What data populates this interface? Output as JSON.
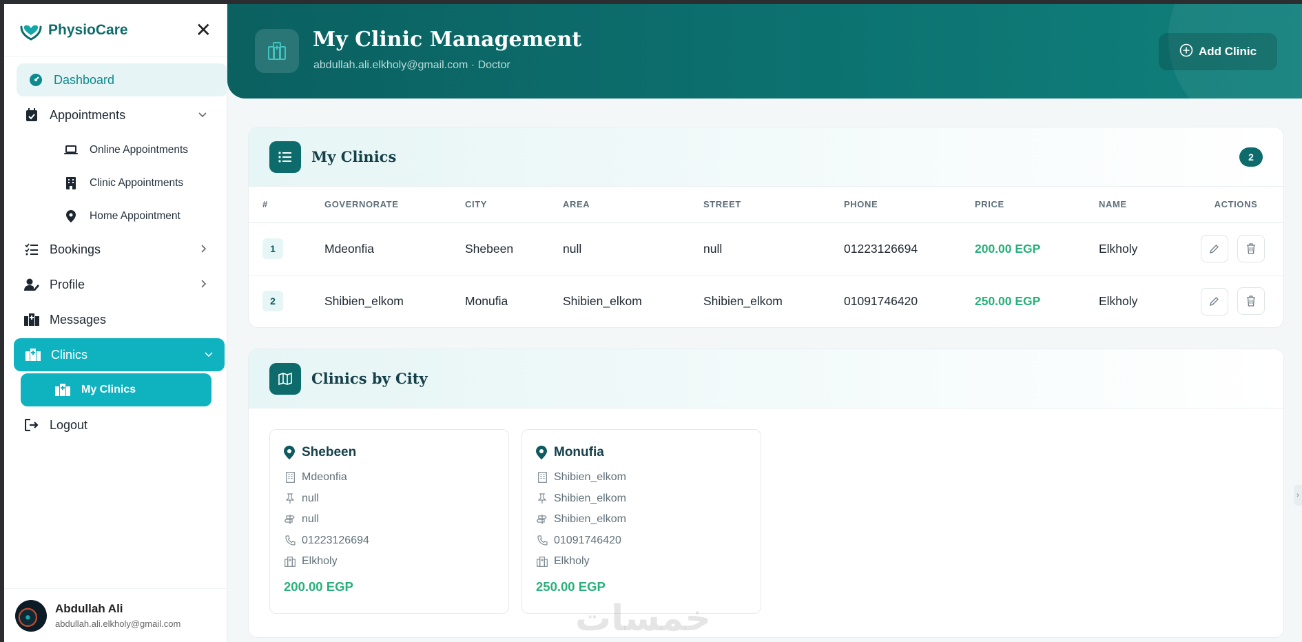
{
  "brand": {
    "name": "PhysioCare",
    "close_label": "✕"
  },
  "sidebar": {
    "dashboard": "Dashboard",
    "appointments": "Appointments",
    "appointment_items": [
      "Online Appointments",
      "Clinic Appointments",
      "Home Appointment"
    ],
    "bookings": "Bookings",
    "profile": "Profile",
    "messages": "Messages",
    "clinics": "Clinics",
    "my_clinics": "My Clinics",
    "logout": "Logout"
  },
  "user": {
    "name": "Abdullah Ali",
    "email": "abdullah.ali.elkholy@gmail.com"
  },
  "header": {
    "title": "My Clinic Management",
    "subtitle": "abdullah.ali.elkholy@gmail.com · Doctor",
    "add_button": "Add Clinic"
  },
  "clinics_table": {
    "title": "My Clinics",
    "count": "2",
    "columns": [
      "#",
      "GOVERNORATE",
      "CITY",
      "AREA",
      "STREET",
      "PHONE",
      "PRICE",
      "NAME",
      "ACTIONS"
    ],
    "rows": [
      {
        "num": "1",
        "governorate": "Mdeonfia",
        "city": "Shebeen",
        "area": "null",
        "street": "null",
        "phone": "01223126694",
        "price": "200.00 EGP",
        "name": "Elkholy"
      },
      {
        "num": "2",
        "governorate": "Shibien_elkom",
        "city": "Monufia",
        "area": "Shibien_elkom",
        "street": "Shibien_elkom",
        "phone": "01091746420",
        "price": "250.00 EGP",
        "name": "Elkholy"
      }
    ]
  },
  "clinics_by_city": {
    "title": "Clinics by City",
    "cards": [
      {
        "city": "Shebeen",
        "governorate": "Mdeonfia",
        "area": "null",
        "street": "null",
        "phone": "01223126694",
        "name": "Elkholy",
        "price": "200.00 EGP"
      },
      {
        "city": "Monufia",
        "governorate": "Shibien_elkom",
        "area": "Shibien_elkom",
        "street": "Shibien_elkom",
        "phone": "01091746420",
        "name": "Elkholy",
        "price": "250.00 EGP"
      }
    ]
  },
  "watermark": "خمسات",
  "colors": {
    "primary": "#0d6b6b",
    "accent": "#0fb2bf",
    "price": "#27b07a"
  }
}
